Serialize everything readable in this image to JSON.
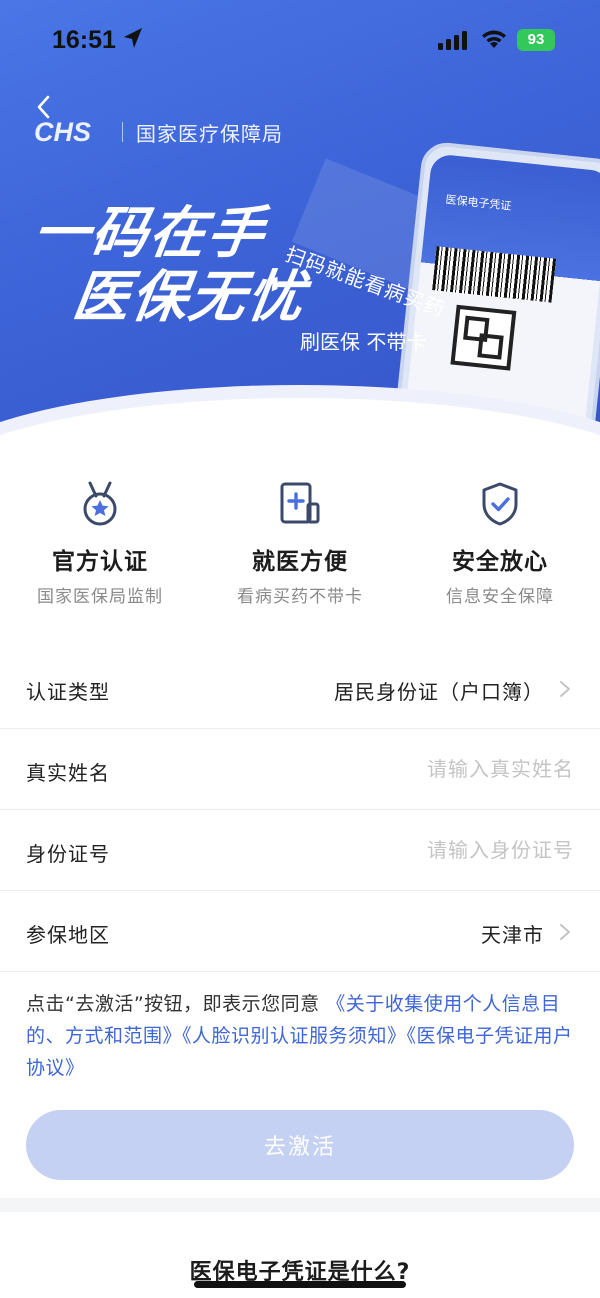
{
  "status_bar": {
    "time": "16:51",
    "battery": "93"
  },
  "hero": {
    "org_name": "国家医疗保障局",
    "slogan_line1": "一码在手",
    "slogan_line2": "医保无忧",
    "tagline_scan": "扫码就能看病买药",
    "tagline_card": "刷医保 不带卡",
    "phone_title": "医保电子凭证"
  },
  "features": [
    {
      "title": "官方认证",
      "subtitle": "国家医保局监制",
      "icon": "medal-icon"
    },
    {
      "title": "就医方便",
      "subtitle": "看病买药不带卡",
      "icon": "medical-card-icon"
    },
    {
      "title": "安全放心",
      "subtitle": "信息安全保障",
      "icon": "shield-check-icon"
    }
  ],
  "form": {
    "cert_type_label": "认证类型",
    "cert_type_value": "居民身份证（户口簿）",
    "name_label": "真实姓名",
    "name_placeholder": "请输入真实姓名",
    "id_label": "身份证号",
    "id_placeholder": "请输入身份证号",
    "region_label": "参保地区",
    "region_value": "天津市"
  },
  "agreement": {
    "prefix": "点击“去激活”按钮，即表示您同意",
    "link1": "《关于收集使用个人信息目的、方式和范围》",
    "link2": "《人脸识别认证服务须知》",
    "link3": "《医保电子凭证用户协议》"
  },
  "activate_button": "去激活",
  "faq_title": "医保电子凭证是什么?",
  "colors": {
    "primary": "#3f66d6",
    "button_disabled": "#c5d1f2",
    "hero": "#4169dc"
  }
}
